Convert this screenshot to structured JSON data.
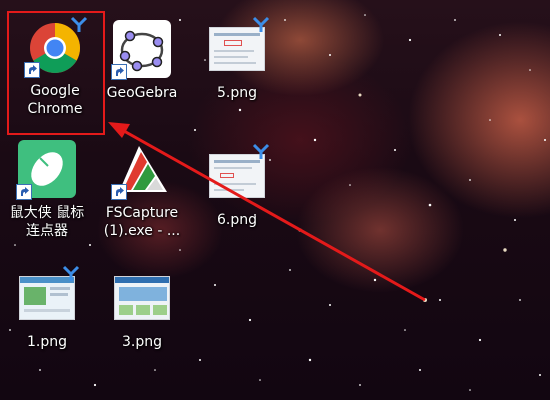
{
  "desktop": {
    "icons": [
      {
        "name": "google-chrome",
        "label": "Google\nChrome",
        "icon": "chrome-icon"
      },
      {
        "name": "geogebra",
        "label": "GeoGebra",
        "icon": "geogebra-icon"
      },
      {
        "name": "5-png",
        "label": "5.png",
        "icon": "image-file-icon"
      },
      {
        "name": "mouse-clicker",
        "label": "鼠大侠 鼠标\n连点器",
        "icon": "mouse-icon"
      },
      {
        "name": "fscapture",
        "label": "FSCapture\n(1).exe - ...",
        "icon": "fscapture-icon"
      },
      {
        "name": "6-png",
        "label": "6.png",
        "icon": "image-file-icon"
      },
      {
        "name": "1-png",
        "label": "1.png",
        "icon": "image-file-icon"
      },
      {
        "name": "3-png",
        "label": "3.png",
        "icon": "image-file-icon"
      }
    ]
  },
  "annotation": {
    "highlight_color": "#e41a1a",
    "arrow_color": "#e41a1a"
  },
  "colors": {
    "chrome_red": "#db4437",
    "chrome_yellow": "#f4b400",
    "chrome_green": "#0f9d58",
    "chrome_blue": "#4285f4",
    "mouse_green": "#3fbf7f",
    "geogebra_purple": "#6557d2"
  }
}
